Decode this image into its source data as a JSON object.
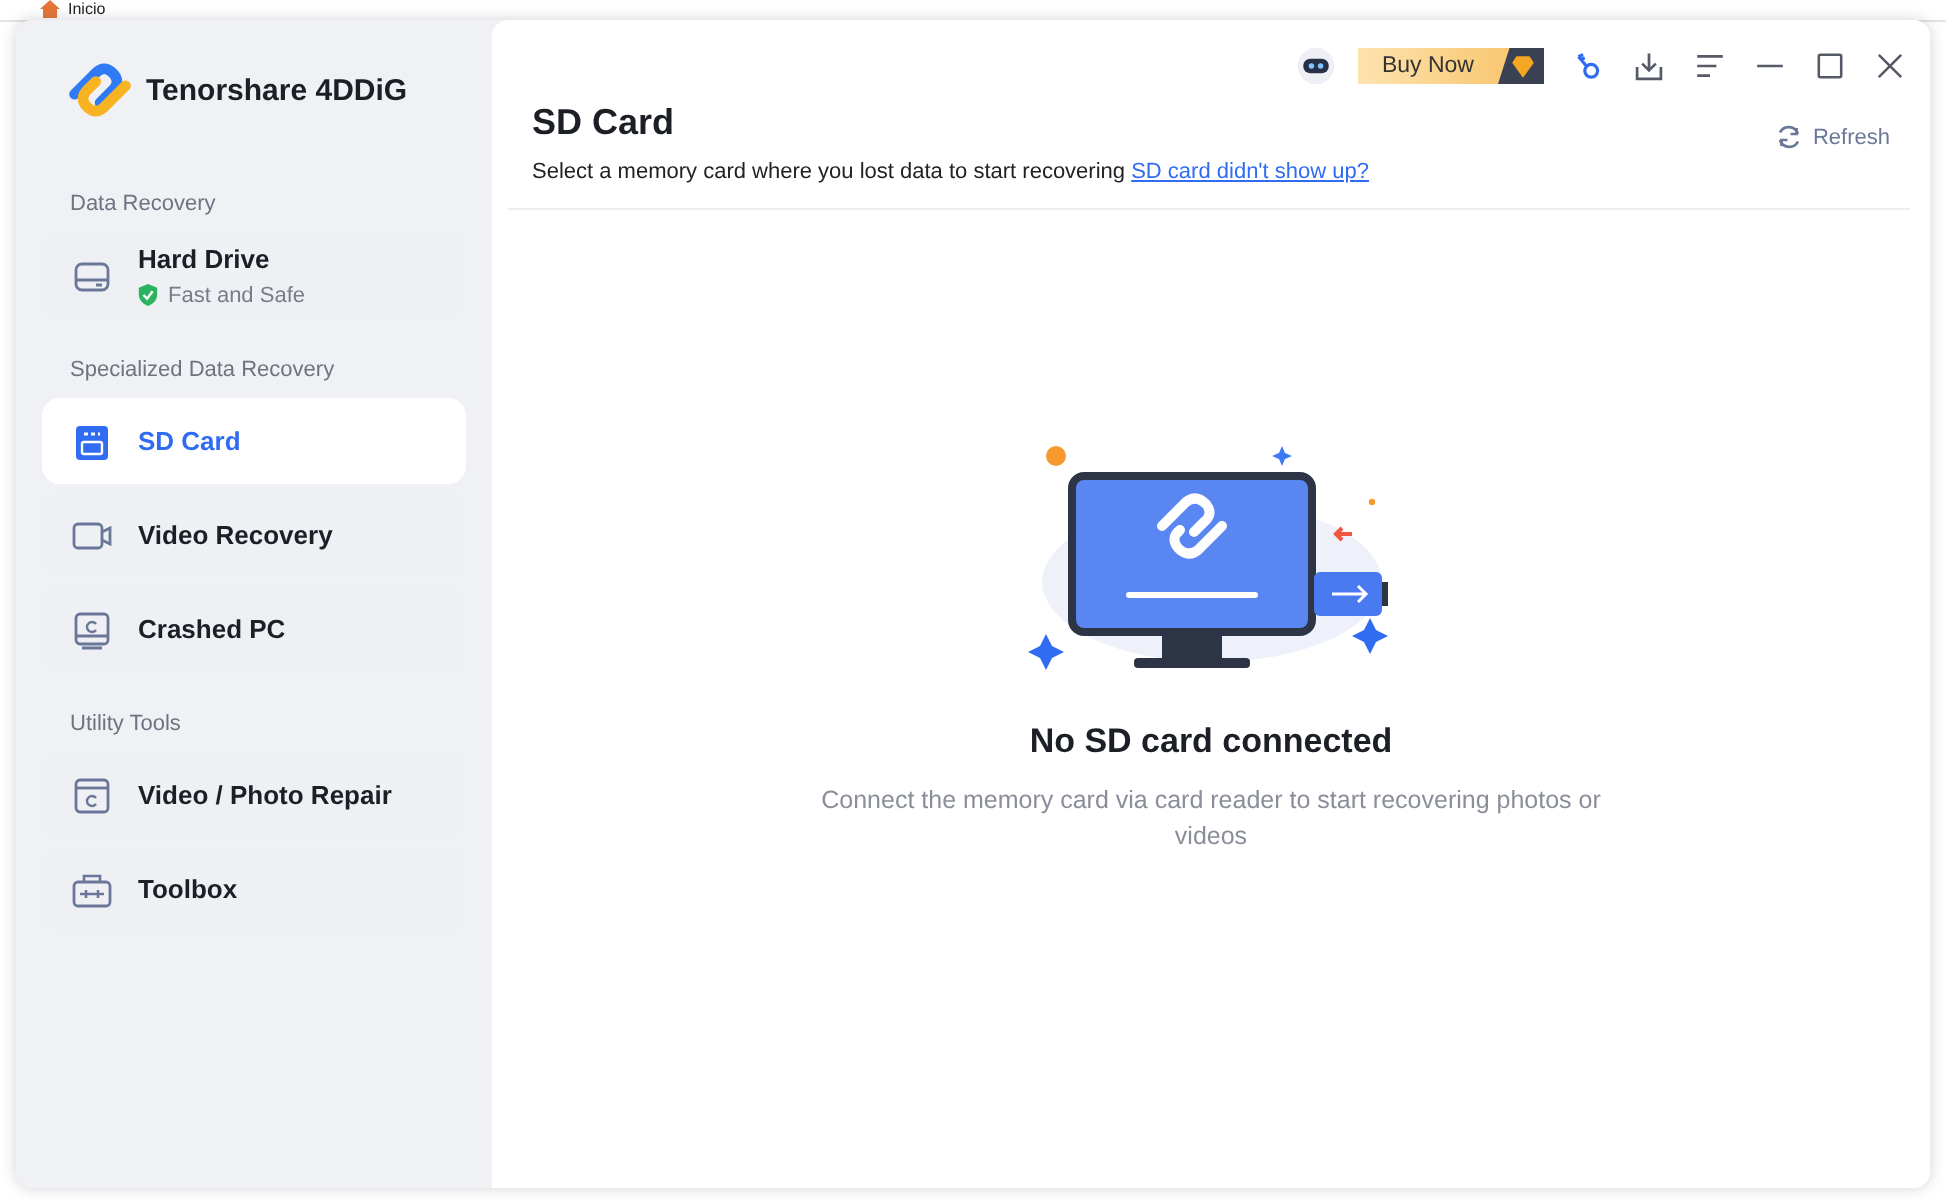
{
  "background_window": {
    "breadcrumb": "Inicio"
  },
  "app": {
    "name": "Tenorshare 4DDiG"
  },
  "toolbar": {
    "buy_button": "Buy Now"
  },
  "sidebar": {
    "sections": [
      {
        "heading": "Data Recovery",
        "items": [
          {
            "label": "Hard Drive",
            "subtitle": "Fast and Safe",
            "kind": "drive",
            "selected": false
          }
        ]
      },
      {
        "heading": "Specialized Data Recovery",
        "items": [
          {
            "label": "SD Card",
            "kind": "sd",
            "selected": true
          },
          {
            "label": "Video Recovery",
            "kind": "video",
            "selected": false
          },
          {
            "label": "Crashed PC",
            "kind": "pc",
            "selected": false
          }
        ]
      },
      {
        "heading": "Utility Tools",
        "items": [
          {
            "label": "Video / Photo Repair",
            "kind": "repair",
            "selected": false
          },
          {
            "label": "Toolbox",
            "kind": "toolbox",
            "selected": false
          }
        ]
      }
    ]
  },
  "page": {
    "title": "SD Card",
    "description": "Select a memory card where you lost data to start recovering",
    "help_link": "SD card didn't show up?",
    "refresh_button": "Refresh"
  },
  "empty_state": {
    "title": "No SD card connected",
    "message": "Connect the memory card via card reader to start recovering photos or videos"
  }
}
